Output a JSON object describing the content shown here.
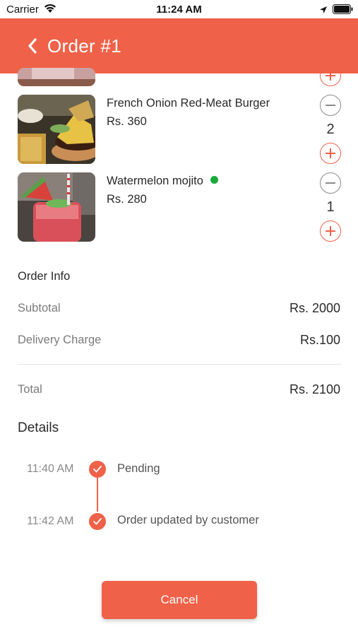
{
  "status_bar": {
    "carrier": "Carrier",
    "time": "11:24 AM"
  },
  "header": {
    "title": "Order #1",
    "accent_color": "#ef6148"
  },
  "items": [
    {
      "name": "French Onion Red-Meat Burger",
      "price": "Rs. 360",
      "quantity": "2",
      "image": "burger-photo"
    },
    {
      "name": "Watermelon mojito",
      "price": "Rs. 280",
      "quantity": "1",
      "image": "mojito-photo",
      "veg_indicator_color": "#1aaa3a"
    }
  ],
  "order_info": {
    "title": "Order Info",
    "subtotal_label": "Subtotal",
    "subtotal_value": "Rs. 2000",
    "delivery_label": "Delivery Charge",
    "delivery_value": "Rs.100",
    "total_label": "Total",
    "total_value": "Rs. 2100"
  },
  "details": {
    "title": "Details",
    "timeline": [
      {
        "time": "11:40 AM",
        "status": "Pending"
      },
      {
        "time": "11:42 AM",
        "status": "Order updated by customer"
      }
    ]
  },
  "actions": {
    "cancel_label": "Cancel"
  }
}
